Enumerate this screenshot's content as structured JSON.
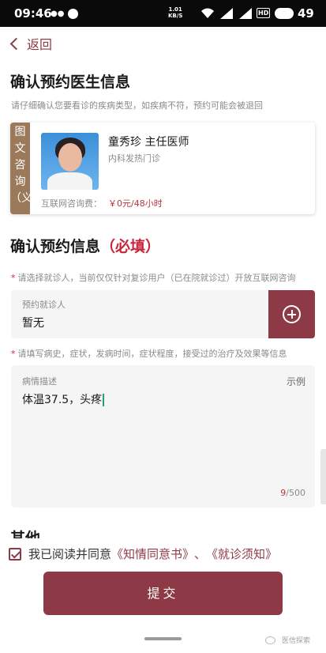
{
  "status_bar": {
    "time": "09:46",
    "dots": "●●",
    "speed_value": "1.01",
    "speed_unit": "KB/S",
    "network_type": "HD",
    "battery": "49"
  },
  "nav": {
    "back_label": "返回"
  },
  "doctor_section": {
    "title": "确认预约医生信息",
    "subtitle": "请仔细确认您要看诊的疾病类型，如疾病不符，预约可能会被退回",
    "card": {
      "tag": "图文咨询（义",
      "name_title": "童秀珍 主任医师",
      "department": "内科发热门诊",
      "fee_label": "互联网咨询费：",
      "fee_value": "￥0元/48小时"
    }
  },
  "appointment_section": {
    "title": "确认预约信息",
    "required": "（必填）",
    "patient_hint": "请选择就诊人，当前仅仅针对复诊用户（已在院就诊过）开放互联网咨询",
    "patient_label": "预约就诊人",
    "patient_value": "暂无",
    "desc_hint": "请填写病史，症状，发病时间，症状程度，接受过的治疗及效果等信息",
    "desc_label": "病情描述",
    "example_label": "示例",
    "desc_text": "体温37.5，头疼",
    "char_count": "9",
    "char_limit": "/500"
  },
  "other_section": {
    "title": "其他"
  },
  "agreement": {
    "prefix": "我已阅读并同意",
    "link1": "《知情同意书》",
    "separator": "、",
    "link2": "《就诊须知》",
    "checked": true
  },
  "submit_label": "提交",
  "watermark": "医信探索",
  "colors": {
    "accent": "#8e3a46",
    "required": "#c8253b",
    "fee": "#b5363f",
    "tag": "#9a7a5a"
  }
}
